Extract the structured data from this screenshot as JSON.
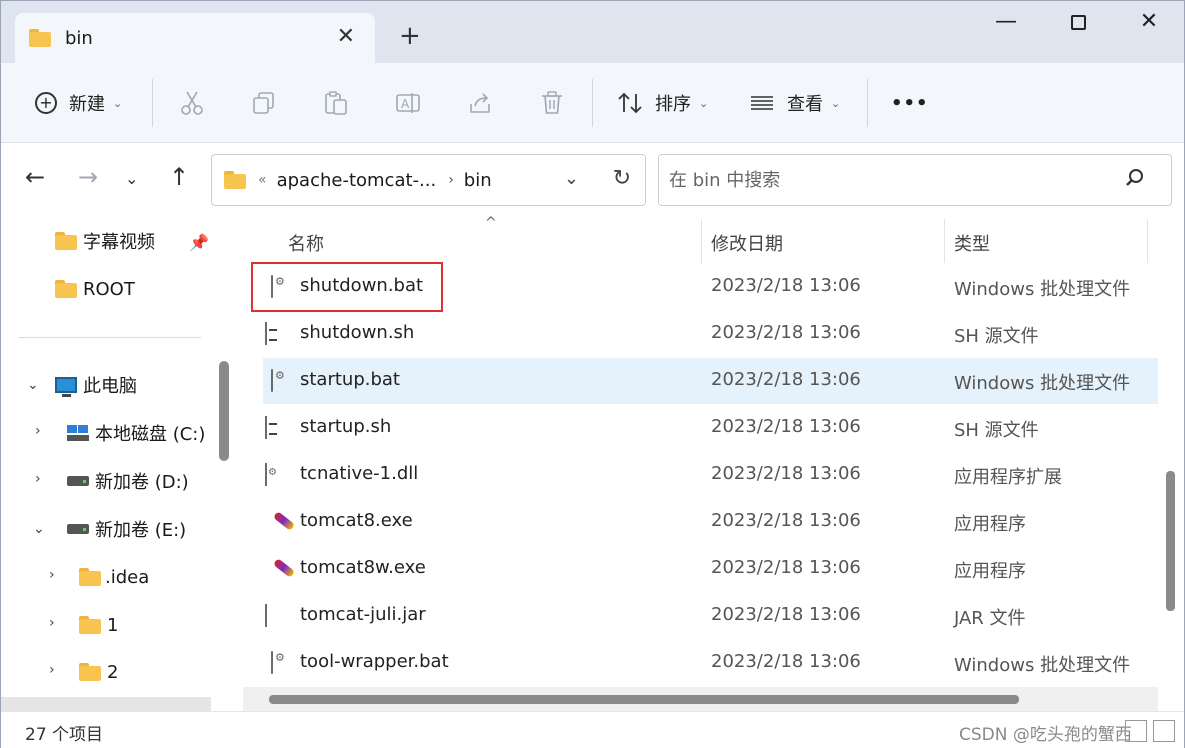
{
  "window": {
    "tab_title": "bin",
    "close_tab_glyph": "✕",
    "new_tab_glyph": "+",
    "minimize_glyph": "—",
    "close_glyph": "✕"
  },
  "toolbar": {
    "new_label": "新建",
    "sort_label": "排序",
    "view_label": "查看",
    "more_glyph": "•••",
    "icons": [
      "cut-icon",
      "copy-icon",
      "paste-icon",
      "rename-icon",
      "share-icon",
      "delete-icon"
    ]
  },
  "address": {
    "overflow": "«",
    "crumbs": [
      "apache-tomcat-...",
      "bin"
    ],
    "separator": "›"
  },
  "search": {
    "placeholder": "在 bin 中搜索"
  },
  "sidebar": {
    "quick": [
      {
        "label": "字幕视频"
      },
      {
        "label": "ROOT"
      }
    ],
    "tree": [
      {
        "label": "此电脑"
      },
      {
        "label": "本地磁盘 (C:)"
      },
      {
        "label": "新加卷 (D:)"
      },
      {
        "label": "新加卷 (E:)"
      },
      {
        "label": ".idea"
      },
      {
        "label": "1"
      },
      {
        "label": "2"
      }
    ]
  },
  "columns": {
    "name": "名称",
    "date": "修改日期",
    "type": "类型"
  },
  "files": [
    {
      "name": "shutdown.bat",
      "date": "2023/2/18 13:06",
      "type": "Windows 批处理文件",
      "icon": "bat"
    },
    {
      "name": "shutdown.sh",
      "date": "2023/2/18 13:06",
      "type": "SH 源文件",
      "icon": "sh"
    },
    {
      "name": "startup.bat",
      "date": "2023/2/18 13:06",
      "type": "Windows 批处理文件",
      "icon": "bat"
    },
    {
      "name": "startup.sh",
      "date": "2023/2/18 13:06",
      "type": "SH 源文件",
      "icon": "sh"
    },
    {
      "name": "tcnative-1.dll",
      "date": "2023/2/18 13:06",
      "type": "应用程序扩展",
      "icon": "dll"
    },
    {
      "name": "tomcat8.exe",
      "date": "2023/2/18 13:06",
      "type": "应用程序",
      "icon": "exe"
    },
    {
      "name": "tomcat8w.exe",
      "date": "2023/2/18 13:06",
      "type": "应用程序",
      "icon": "exe"
    },
    {
      "name": "tomcat-juli.jar",
      "date": "2023/2/18 13:06",
      "type": "JAR 文件",
      "icon": "jar"
    },
    {
      "name": "tool-wrapper.bat",
      "date": "2023/2/18 13:06",
      "type": "Windows 批处理文件",
      "icon": "bat"
    }
  ],
  "status": {
    "item_count": "27 个项目",
    "watermark": "CSDN @吃头孢的蟹西"
  },
  "colors": {
    "accent_selected_row": "#e5f1fb",
    "highlight_box": "#e03131",
    "folder": "#f7c44f"
  }
}
